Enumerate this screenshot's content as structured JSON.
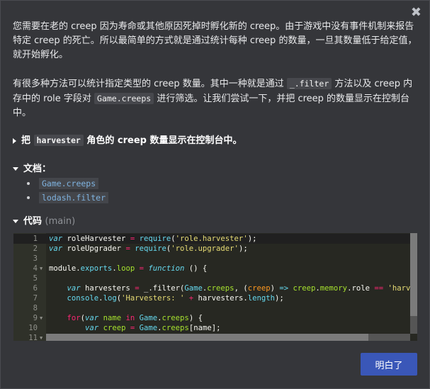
{
  "dialog": {
    "close_symbol": "✖",
    "intro": {
      "p1": "您需要在老的 creep 因为寿命或其他原因死掉时孵化新的 creep。由于游戏中没有事件机制来报告特定 creep 的死亡。所以最简单的方式就是通过统计每种 creep 的数量，一旦其数量低于给定值，就开始孵化。",
      "p2_a": "有很多种方法可以统计指定类型的 creep 数量。其中一种就是通过 ",
      "p2_code1": "_.filter",
      "p2_b": " 方法以及 creep 内存中的 role 字段对 ",
      "p2_code2": "Game.creeps",
      "p2_c": " 进行筛选。让我们尝试一下，并把 creep 的数量显示在控制台中。"
    },
    "task": {
      "prefix": "把 ",
      "code": "harvester",
      "suffix": " 角色的 creep 数量显示在控制台中。"
    },
    "docs": {
      "heading": "文档：",
      "links": [
        "Game.creeps",
        "lodash.filter"
      ]
    },
    "code_section": {
      "heading": "代码",
      "branch": "(main)",
      "line_numbers": [
        "1",
        "2",
        "3",
        "4",
        "5",
        "6",
        "7",
        "8",
        "9",
        "10",
        "11"
      ]
    },
    "ok_button": "明白了"
  },
  "colors": {
    "dialog_bg": "#35363a",
    "editor_bg": "#272822",
    "button_bg": "#3a57b8",
    "link": "#7fb3e0"
  }
}
